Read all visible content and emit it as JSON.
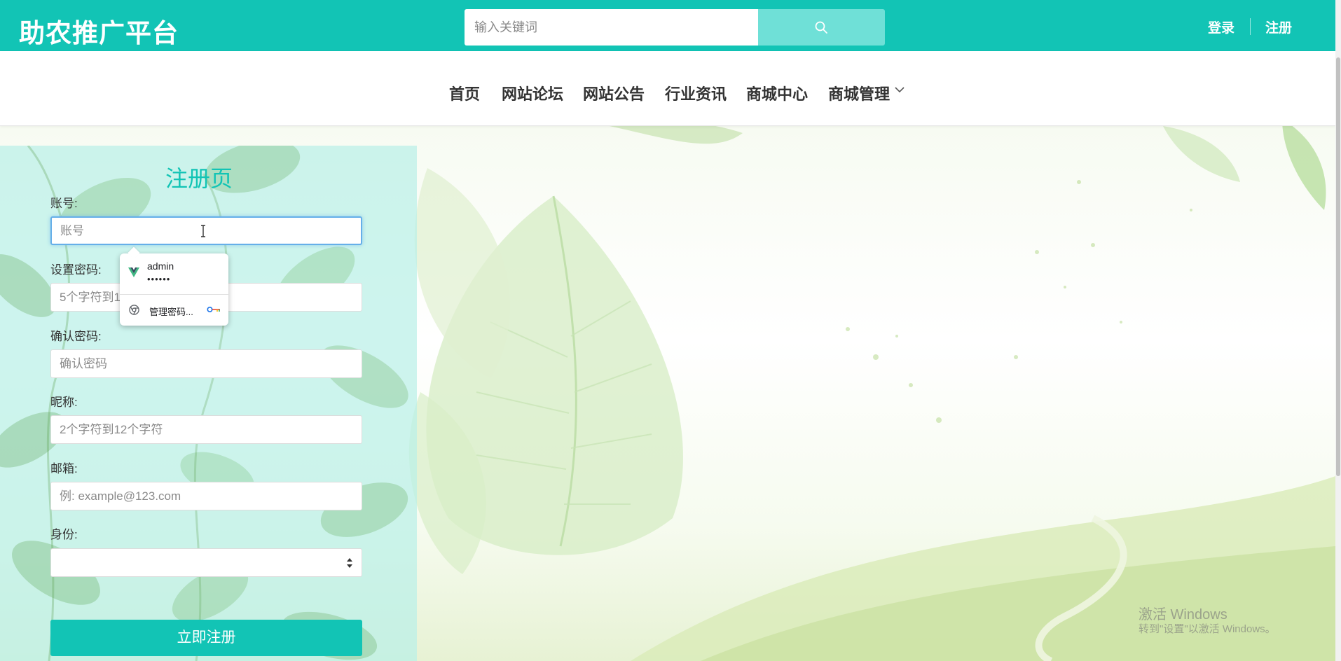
{
  "header": {
    "logo": "助农推广平台",
    "search_placeholder": "输入关键词",
    "search_button_icon": "search-icon",
    "login_label": "登录",
    "register_label": "注册"
  },
  "nav": {
    "items": [
      {
        "label": "首页"
      },
      {
        "label": "网站论坛"
      },
      {
        "label": "网站公告"
      },
      {
        "label": "行业资讯"
      },
      {
        "label": "商城中心"
      },
      {
        "label": "商城管理",
        "icon": "chevron-down-icon"
      }
    ]
  },
  "register_form": {
    "title": "注册页",
    "fields": [
      {
        "label": "账号:",
        "placeholder": "账号",
        "value": ""
      },
      {
        "label": "设置密码:",
        "placeholder": "5个字符到16个字符",
        "value": ""
      },
      {
        "label": "确认密码:",
        "placeholder": "确认密码",
        "value": ""
      },
      {
        "label": "昵称:",
        "placeholder": "2个字符到12个字符",
        "value": ""
      },
      {
        "label": "邮箱:",
        "placeholder": "例: example@123.com",
        "value": ""
      },
      {
        "label": "身份:",
        "selected": ""
      }
    ],
    "submit_label": "立即注册"
  },
  "autofill": {
    "username": "admin",
    "password_mask": "••••••",
    "manage_label": "管理密码..."
  },
  "watermark": {
    "title": "激活 Windows",
    "subtitle": "转到\"设置\"以激活 Windows。"
  },
  "colors": {
    "brand": "#12c4b5",
    "search_button": "#6fe0d7",
    "panel_overlay": "#baf0e8",
    "focus_ring": "#66afe9"
  }
}
